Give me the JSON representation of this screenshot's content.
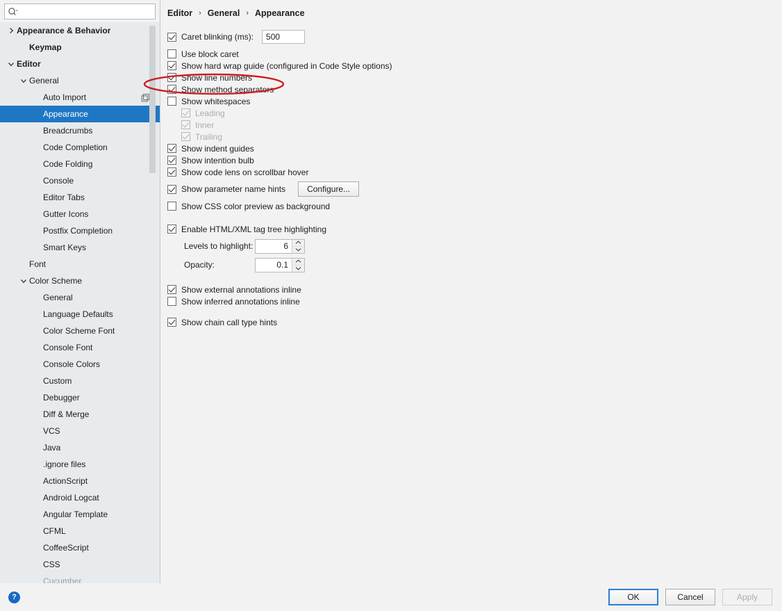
{
  "search": {
    "placeholder": "",
    "value": "",
    "icon": "search-icon"
  },
  "sidebar": {
    "items": [
      {
        "label": "Appearance & Behavior",
        "indent": 0,
        "arrow": "chevron-right",
        "bold": true,
        "selected": false
      },
      {
        "label": "Keymap",
        "indent": 1,
        "arrow": "none",
        "bold": true,
        "selected": false
      },
      {
        "label": "Editor",
        "indent": 0,
        "arrow": "chevron-down",
        "bold": true,
        "selected": false
      },
      {
        "label": "General",
        "indent": 1,
        "arrow": "chevron-down",
        "bold": false,
        "selected": false
      },
      {
        "label": "Auto Import",
        "indent": 2,
        "arrow": "none",
        "bold": false,
        "selected": false,
        "trail_icon": "copy-icon"
      },
      {
        "label": "Appearance",
        "indent": 2,
        "arrow": "none",
        "bold": false,
        "selected": true
      },
      {
        "label": "Breadcrumbs",
        "indent": 2,
        "arrow": "none",
        "bold": false,
        "selected": false
      },
      {
        "label": "Code Completion",
        "indent": 2,
        "arrow": "none",
        "bold": false,
        "selected": false
      },
      {
        "label": "Code Folding",
        "indent": 2,
        "arrow": "none",
        "bold": false,
        "selected": false
      },
      {
        "label": "Console",
        "indent": 2,
        "arrow": "none",
        "bold": false,
        "selected": false
      },
      {
        "label": "Editor Tabs",
        "indent": 2,
        "arrow": "none",
        "bold": false,
        "selected": false
      },
      {
        "label": "Gutter Icons",
        "indent": 2,
        "arrow": "none",
        "bold": false,
        "selected": false
      },
      {
        "label": "Postfix Completion",
        "indent": 2,
        "arrow": "none",
        "bold": false,
        "selected": false
      },
      {
        "label": "Smart Keys",
        "indent": 2,
        "arrow": "none",
        "bold": false,
        "selected": false
      },
      {
        "label": "Font",
        "indent": 1,
        "arrow": "none",
        "bold": false,
        "selected": false
      },
      {
        "label": "Color Scheme",
        "indent": 1,
        "arrow": "chevron-down",
        "bold": false,
        "selected": false
      },
      {
        "label": "General",
        "indent": 2,
        "arrow": "none",
        "bold": false,
        "selected": false
      },
      {
        "label": "Language Defaults",
        "indent": 2,
        "arrow": "none",
        "bold": false,
        "selected": false
      },
      {
        "label": "Color Scheme Font",
        "indent": 2,
        "arrow": "none",
        "bold": false,
        "selected": false
      },
      {
        "label": "Console Font",
        "indent": 2,
        "arrow": "none",
        "bold": false,
        "selected": false
      },
      {
        "label": "Console Colors",
        "indent": 2,
        "arrow": "none",
        "bold": false,
        "selected": false
      },
      {
        "label": "Custom",
        "indent": 2,
        "arrow": "none",
        "bold": false,
        "selected": false
      },
      {
        "label": "Debugger",
        "indent": 2,
        "arrow": "none",
        "bold": false,
        "selected": false
      },
      {
        "label": "Diff & Merge",
        "indent": 2,
        "arrow": "none",
        "bold": false,
        "selected": false
      },
      {
        "label": "VCS",
        "indent": 2,
        "arrow": "none",
        "bold": false,
        "selected": false
      },
      {
        "label": "Java",
        "indent": 2,
        "arrow": "none",
        "bold": false,
        "selected": false
      },
      {
        "label": ".ignore files",
        "indent": 2,
        "arrow": "none",
        "bold": false,
        "selected": false
      },
      {
        "label": "ActionScript",
        "indent": 2,
        "arrow": "none",
        "bold": false,
        "selected": false
      },
      {
        "label": "Android Logcat",
        "indent": 2,
        "arrow": "none",
        "bold": false,
        "selected": false
      },
      {
        "label": "Angular Template",
        "indent": 2,
        "arrow": "none",
        "bold": false,
        "selected": false
      },
      {
        "label": "CFML",
        "indent": 2,
        "arrow": "none",
        "bold": false,
        "selected": false
      },
      {
        "label": "CoffeeScript",
        "indent": 2,
        "arrow": "none",
        "bold": false,
        "selected": false
      },
      {
        "label": "CSS",
        "indent": 2,
        "arrow": "none",
        "bold": false,
        "selected": false
      },
      {
        "label": "Cucumber",
        "indent": 2,
        "arrow": "none",
        "bold": false,
        "selected": false,
        "clipped": true
      }
    ]
  },
  "breadcrumb": {
    "items": [
      "Editor",
      "General",
      "Appearance"
    ],
    "separator": "›"
  },
  "settings": {
    "caret_blinking": {
      "label": "Caret blinking (ms):",
      "checked": true,
      "value": "500"
    },
    "use_block_caret": {
      "label": "Use block caret",
      "checked": false
    },
    "show_hard_wrap_guide": {
      "label": "Show hard wrap guide (configured in Code Style options)",
      "checked": true
    },
    "show_line_numbers": {
      "label": "Show line numbers",
      "checked": true
    },
    "show_method_separators": {
      "label": "Show method separators",
      "checked": true,
      "annotated": true
    },
    "show_whitespaces": {
      "label": "Show whitespaces",
      "checked": false
    },
    "whitespace_leading": {
      "label": "Leading",
      "checked": true,
      "disabled": true
    },
    "whitespace_inner": {
      "label": "Inner",
      "checked": true,
      "disabled": true
    },
    "whitespace_trailing": {
      "label": "Trailing",
      "checked": true,
      "disabled": true
    },
    "show_indent_guides": {
      "label": "Show indent guides",
      "checked": true
    },
    "show_intention_bulb": {
      "label": "Show intention bulb",
      "checked": true
    },
    "show_code_lens": {
      "label": "Show code lens on scrollbar hover",
      "checked": true
    },
    "show_parameter_name_hints": {
      "label": "Show parameter name hints",
      "checked": true,
      "button": "Configure..."
    },
    "show_css_color_preview": {
      "label": "Show CSS color preview as background",
      "checked": false
    },
    "enable_tag_tree_highlighting": {
      "label": "Enable HTML/XML tag tree highlighting",
      "checked": true
    },
    "levels_to_highlight": {
      "label": "Levels to highlight:",
      "value": "6"
    },
    "opacity": {
      "label": "Opacity:",
      "value": "0.1"
    },
    "show_external_annotations": {
      "label": "Show external annotations inline",
      "checked": true
    },
    "show_inferred_annotations": {
      "label": "Show inferred annotations inline",
      "checked": false
    },
    "show_chain_call_type_hints": {
      "label": "Show chain call type hints",
      "checked": true
    }
  },
  "footer": {
    "help_label": "?",
    "ok_label": "OK",
    "cancel_label": "Cancel",
    "apply_label": "Apply"
  },
  "colors": {
    "selection": "#1f77c4",
    "annotation": "#cc1f1f",
    "sidebar_bg": "#e7ebee",
    "panel_bg": "#f2f2f2",
    "help_blue": "#1669c4"
  }
}
